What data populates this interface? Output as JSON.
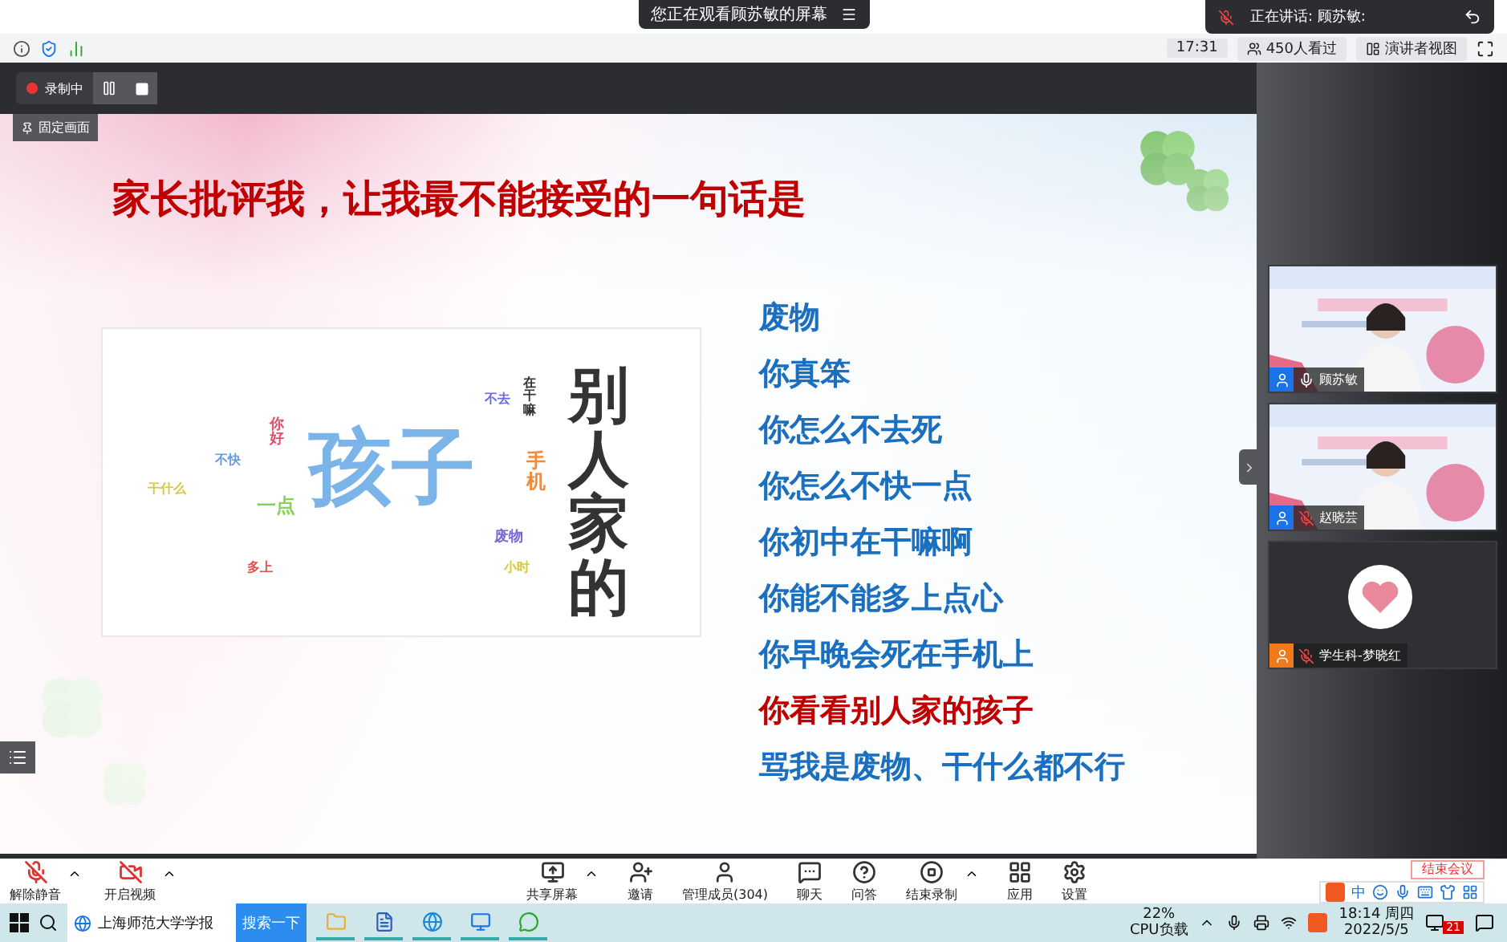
{
  "share_banner": {
    "text": "您正在观看顾苏敏的屏幕"
  },
  "speaking_notice": {
    "label": "正在讲话: 顾苏敏:"
  },
  "info_bar": {
    "time": "17:31",
    "viewers": "450人看过",
    "view_mode": "演讲者视图"
  },
  "recording": {
    "status": "录制中"
  },
  "pin_label": "固定画面",
  "slide": {
    "title": "家长批评我，让我最不能接受的一句话是",
    "word_cloud": [
      {
        "text": "干什么",
        "color": "#d8c840",
        "kind": "tiny",
        "vertical": false
      },
      {
        "text": "不快",
        "color": "#6a9ad8",
        "kind": "tiny",
        "vertical": false
      },
      {
        "text": "一点",
        "color": "#8ad35a",
        "kind": "medium",
        "vertical": false
      },
      {
        "text": "多上",
        "color": "#e05050",
        "kind": "tiny",
        "vertical": false
      },
      {
        "text": "你好",
        "color": "#e0506a",
        "kind": "small",
        "vertical": true
      },
      {
        "text": "孩子",
        "color": "#7ab4e8",
        "kind": "huge",
        "vertical": false
      },
      {
        "text": "不去",
        "color": "#6a6ad8",
        "kind": "tiny",
        "vertical": false
      },
      {
        "text": "废物",
        "color": "#7a6ad8",
        "kind": "small",
        "vertical": false
      },
      {
        "text": "小时",
        "color": "#d8c840",
        "kind": "tiny",
        "vertical": false
      },
      {
        "text": "在干嘛",
        "color": "#333333",
        "kind": "tiny",
        "vertical": true
      },
      {
        "text": "手机",
        "color": "#f08a3c",
        "kind": "medium",
        "vertical": true
      },
      {
        "text": "别人家的",
        "color": "#333333",
        "kind": "big",
        "vertical": true
      }
    ],
    "phrases": [
      {
        "text": "废物",
        "emphasis": false
      },
      {
        "text": "你真笨",
        "emphasis": false
      },
      {
        "text": "你怎么不去死",
        "emphasis": false
      },
      {
        "text": "你怎么不快一点",
        "emphasis": false
      },
      {
        "text": "你初中在干嘛啊",
        "emphasis": false
      },
      {
        "text": "你能不能多上点心",
        "emphasis": false
      },
      {
        "text": "你早晚会死在手机上",
        "emphasis": false
      },
      {
        "text": "你看看别人家的孩子",
        "emphasis": true
      },
      {
        "text": "骂我是废物、干什么都不行",
        "emphasis": false
      }
    ]
  },
  "participants": [
    {
      "name": "顾苏敏",
      "muted": false,
      "kind": "video"
    },
    {
      "name": "赵晓芸",
      "muted": true,
      "kind": "video"
    },
    {
      "name": "学生科-梦晓红",
      "muted": true,
      "kind": "avatar"
    }
  ],
  "toolbar": {
    "left": [
      {
        "label": "解除静音",
        "kind": "mic-off",
        "caret": true
      },
      {
        "label": "开启视频",
        "kind": "video-off",
        "caret": true
      }
    ],
    "center": [
      {
        "label": "共享屏幕",
        "kind": "share",
        "caret": true
      },
      {
        "label": "邀请",
        "kind": "invite",
        "caret": false
      },
      {
        "label": "管理成员(304)",
        "kind": "members",
        "caret": false
      },
      {
        "label": "聊天",
        "kind": "chat",
        "caret": false
      },
      {
        "label": "问答",
        "kind": "qa",
        "caret": false
      },
      {
        "label": "结束录制",
        "kind": "stop-record",
        "caret": true
      },
      {
        "label": "应用",
        "kind": "apps",
        "caret": false
      },
      {
        "label": "设置",
        "kind": "settings",
        "caret": false
      }
    ],
    "end_button": "结束会议"
  },
  "ime_bar": {
    "mode": "中"
  },
  "taskbar": {
    "search_text": "上海师范大学学报",
    "search_button": "搜索一下",
    "cpu_percent": "22%",
    "cpu_label": "CPU负载",
    "time": "18:14 周四",
    "date": "2022/5/5",
    "badge": "21"
  }
}
